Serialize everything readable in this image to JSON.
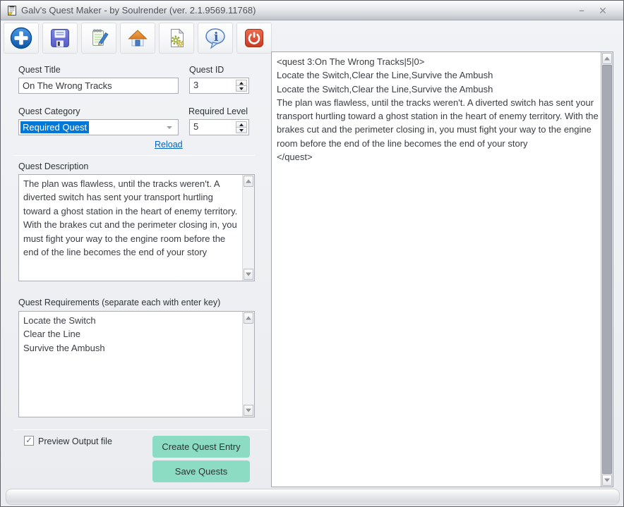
{
  "window": {
    "title": "Galv's Quest Maker - by Soulrender (ver. 2.1.9569.11768)",
    "minimize_glyph": "–",
    "close_glyph": "✕"
  },
  "toolbar": {
    "buttons": [
      {
        "id": "new-quest",
        "icon": "plus-circle-icon"
      },
      {
        "id": "save",
        "icon": "floppy-disk-icon"
      },
      {
        "id": "edit",
        "icon": "notepad-pencil-icon"
      },
      {
        "id": "home",
        "icon": "home-icon"
      },
      {
        "id": "generate",
        "icon": "document-gears-icon"
      },
      {
        "id": "info",
        "icon": "info-bubble-icon"
      },
      {
        "id": "exit",
        "icon": "power-icon"
      }
    ]
  },
  "form": {
    "quest_title": {
      "label": "Quest Title",
      "value": "On The Wrong Tracks"
    },
    "quest_id": {
      "label": "Quest ID",
      "value": "3"
    },
    "quest_category": {
      "label": "Quest Category",
      "value": "Required Quest"
    },
    "required_level": {
      "label": "Required Level",
      "value": "5"
    },
    "reload_label": "Reload",
    "description": {
      "label": "Quest Description",
      "value": "The plan was flawless, until the tracks weren't. A diverted switch has sent your transport hurtling toward a ghost station in the heart of enemy territory. With the brakes cut and the perimeter closing in, you must fight your way to the engine room before the end of the line becomes the end of your story"
    },
    "requirements": {
      "label": "Quest Requirements (separate each with enter key)",
      "value": "Locate the Switch\nClear the Line\nSurvive the Ambush"
    },
    "preview": {
      "label": "Preview Output file",
      "checked": true,
      "check_glyph": "✓"
    },
    "create_button": "Create Quest Entry",
    "save_button": "Save Quests"
  },
  "preview_output": {
    "content": "<quest 3:On The Wrong Tracks|5|0>\nLocate the Switch,Clear the Line,Survive the Ambush\nLocate the Switch,Clear the Line,Survive the Ambush\nThe plan was flawless, until the tracks weren't. A diverted switch has sent your transport hurtling toward a ghost station in the heart of enemy territory. With the brakes cut and the perimeter closing in, you must fight your way to the engine room before the end of the line becomes the end of your story\n</quest>"
  },
  "colors": {
    "selection_blue": "#0078d7",
    "mint_button": "#8bdcc2",
    "link_blue": "#0563c1",
    "exit_red": "#d8452e"
  }
}
